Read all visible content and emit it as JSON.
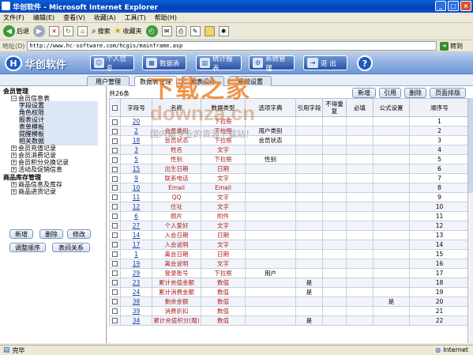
{
  "window": {
    "title": "华创软件 - Microsoft Internet Explorer",
    "controls": [
      "_",
      "□",
      "×"
    ]
  },
  "menu": [
    "文件(F)",
    "编辑(E)",
    "查看(V)",
    "收藏(A)",
    "工具(T)",
    "帮助(H)"
  ],
  "toolbar": {
    "back": "后退",
    "search": "搜索",
    "favorites": "收藏夹"
  },
  "address": {
    "label": "地址(D)",
    "url": "http://www.hc-software.com/hcgis/mainframe.asp",
    "go": "转到"
  },
  "banner": {
    "logo_text": "华创软件",
    "nav": [
      "个人信息",
      "数据表",
      "统计报表",
      "系统管理",
      "退 出"
    ],
    "help": "?"
  },
  "subtabs": [
    "用户管理",
    "数据表管理",
    "报表设计",
    "系统设置"
  ],
  "sidebar": {
    "tree": [
      {
        "label": "会员管理"
      },
      {
        "label": "会员信息表"
      },
      {
        "label": "字段设置"
      },
      {
        "label": "角色权限"
      },
      {
        "label": "报表设计"
      },
      {
        "label": "表单模板"
      },
      {
        "label": "提醒模板"
      },
      {
        "label": "相关数据"
      },
      {
        "label": "会员充值记录"
      },
      {
        "label": "会员消费记录"
      },
      {
        "label": "会员积分兑换记录"
      },
      {
        "label": "活动及促销信息"
      },
      {
        "label": "商品库存管理"
      },
      {
        "label": "商品信息及库存"
      },
      {
        "label": "商品进货记录"
      }
    ],
    "buttons": [
      "新增",
      "删除",
      "修改",
      "调整顺序",
      "表间关系"
    ]
  },
  "main": {
    "count": "共26条",
    "actions": [
      "新增",
      "引用",
      "删除",
      "页面排版"
    ],
    "columns": [
      "字段号",
      "名称",
      "数据类型",
      "选项字典",
      "引用字段",
      "不得重复",
      "必填",
      "公式设置",
      "顺序号"
    ],
    "rows": [
      [
        "20",
        "",
        "下拉框",
        "",
        "",
        "",
        "",
        "",
        "1"
      ],
      [
        "2",
        "会员类别",
        "下拉框",
        "用户类别",
        "",
        "",
        "",
        "",
        "2"
      ],
      [
        "18",
        "会员状态",
        "下拉框",
        "会员状态",
        "",
        "",
        "",
        "",
        "3"
      ],
      [
        "3",
        "姓名",
        "文字",
        "",
        "",
        "",
        "",
        "",
        "4"
      ],
      [
        "5",
        "性别",
        "下拉框",
        "性别",
        "",
        "",
        "",
        "",
        "5"
      ],
      [
        "15",
        "出生日期",
        "日期",
        "",
        "",
        "",
        "",
        "",
        "6"
      ],
      [
        "9",
        "联系电话",
        "文字",
        "",
        "",
        "",
        "",
        "",
        "7"
      ],
      [
        "10",
        "Email",
        "Email",
        "",
        "",
        "",
        "",
        "",
        "8"
      ],
      [
        "11",
        "QQ",
        "文字",
        "",
        "",
        "",
        "",
        "",
        "9"
      ],
      [
        "12",
        "住址",
        "文字",
        "",
        "",
        "",
        "",
        "",
        "10"
      ],
      [
        "6",
        "照片",
        "附件",
        "",
        "",
        "",
        "",
        "",
        "11"
      ],
      [
        "27",
        "个人爱好",
        "文字",
        "",
        "",
        "",
        "",
        "",
        "12"
      ],
      [
        "14",
        "入会日期",
        "日期",
        "",
        "",
        "",
        "",
        "",
        "13"
      ],
      [
        "17",
        "入会说明",
        "文字",
        "",
        "",
        "",
        "",
        "",
        "14"
      ],
      [
        "1",
        "离会日期",
        "日期",
        "",
        "",
        "",
        "",
        "",
        "15"
      ],
      [
        "19",
        "离会说明",
        "文字",
        "",
        "",
        "",
        "",
        "",
        "16"
      ],
      [
        "29",
        "登录账号",
        "下拉框",
        "用户",
        "",
        "",
        "",
        "",
        "17"
      ],
      [
        "23",
        "累计充值金额",
        "数值",
        "",
        "是",
        "",
        "",
        "",
        "18"
      ],
      [
        "24",
        "累计消费金额",
        "数值",
        "",
        "是",
        "",
        "",
        "",
        "19"
      ],
      [
        "38",
        "剩余金额",
        "数值",
        "",
        "",
        "",
        "",
        "是",
        "20"
      ],
      [
        "39",
        "消费折扣",
        "数值",
        "",
        "",
        "",
        "",
        "",
        "21"
      ],
      [
        "34",
        "累计充值积分(赠)",
        "数值",
        "",
        "是",
        "",
        "",
        "",
        "22"
      ]
    ]
  },
  "status": {
    "text": "完毕",
    "zone": "Internet"
  },
  "watermark": {
    "line1": "下载之家",
    "line2": "downza.cn",
    "line3": "国内最专业的资源下载站！"
  },
  "colors": {
    "title_blue": "#0a4fd0",
    "banner_blue": "#6d96d6",
    "watermark_orange": "#ec8228",
    "link": "#1a3a9a"
  }
}
